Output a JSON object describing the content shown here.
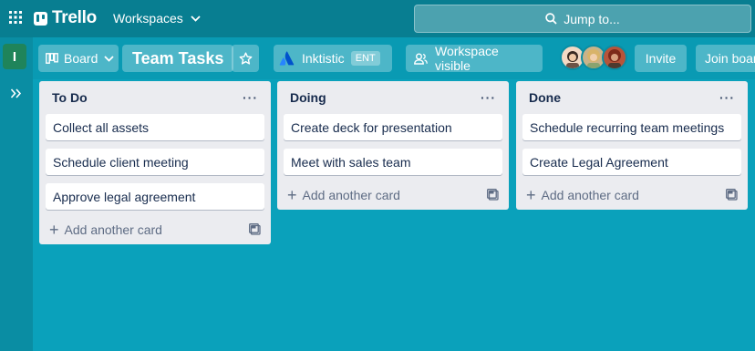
{
  "app": {
    "name": "Trello",
    "nav_workspaces": "Workspaces"
  },
  "search": {
    "label": "Jump to..."
  },
  "rail": {
    "workspace_initial": "I"
  },
  "board": {
    "view_label": "Board",
    "title": "Team Tasks",
    "workspace_name": "Inktistic",
    "workspace_badge": "ENT",
    "visibility_label": "Workspace visible",
    "invite_label": "Invite",
    "join_label": "Join board"
  },
  "lists": [
    {
      "title": "To Do",
      "cards": [
        "Collect all assets",
        "Schedule client meeting",
        "Approve legal agreement"
      ],
      "add_label": "Add another card"
    },
    {
      "title": "Doing",
      "cards": [
        "Create deck for presentation",
        "Meet with sales team"
      ],
      "add_label": "Add another card"
    },
    {
      "title": "Done",
      "cards": [
        "Schedule recurring team meetings",
        "Create Legal Agreement"
      ],
      "add_label": "Add another card"
    }
  ],
  "colors": {
    "board_background": "#0aa1bb",
    "topbar": "#087e91",
    "workspace_avatar": "#1f845a",
    "list_background": "#ebecf0"
  }
}
